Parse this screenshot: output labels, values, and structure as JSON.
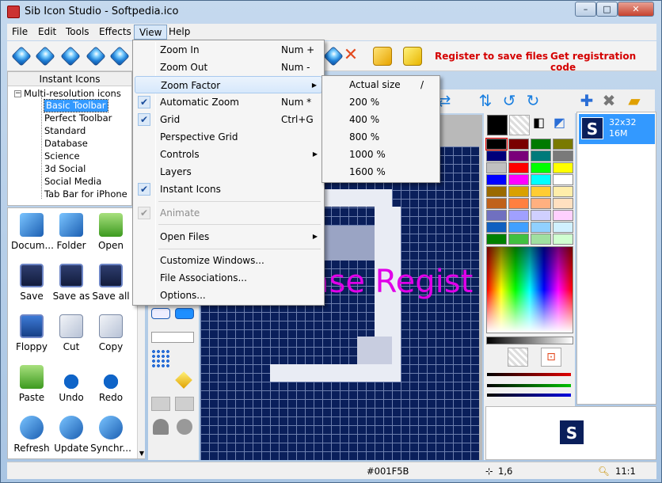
{
  "window": {
    "title": "Sib Icon Studio - Softpedia.ico",
    "minimize": "–",
    "maximize": "□",
    "close": "✕"
  },
  "menubar": {
    "items": [
      "File",
      "Edit",
      "Tools",
      "Effects",
      "View",
      "Help"
    ],
    "active": "View"
  },
  "toolbar": {
    "register_save": "Register to save files",
    "registration_code": "Get registration code"
  },
  "left_panel": {
    "header": "Instant Icons",
    "tree_root": "Multi-resolution icons",
    "tree_items": [
      "Basic Toolbar",
      "Perfect Toolbar",
      "Standard",
      "Database",
      "Science",
      "3d Social",
      "Social Media",
      "Tab Bar for iPhone"
    ],
    "selected": "Basic Toolbar"
  },
  "icon_grid": {
    "items": [
      {
        "label": "Docum...",
        "icon": "document-icon"
      },
      {
        "label": "Folder",
        "icon": "folder-icon"
      },
      {
        "label": "Open",
        "icon": "open-icon"
      },
      {
        "label": "Save",
        "icon": "save-icon"
      },
      {
        "label": "Save as",
        "icon": "save-as-icon"
      },
      {
        "label": "Save all",
        "icon": "save-all-icon"
      },
      {
        "label": "Floppy",
        "icon": "floppy-icon"
      },
      {
        "label": "Cut",
        "icon": "cut-icon"
      },
      {
        "label": "Copy",
        "icon": "copy-icon"
      },
      {
        "label": "Paste",
        "icon": "paste-icon"
      },
      {
        "label": "Undo",
        "icon": "undo-icon"
      },
      {
        "label": "Redo",
        "icon": "redo-icon"
      },
      {
        "label": "Refresh",
        "icon": "refresh-icon"
      },
      {
        "label": "Update",
        "icon": "update-icon"
      },
      {
        "label": "Synchr...",
        "icon": "synchronize-icon"
      }
    ]
  },
  "view_menu": {
    "items": [
      {
        "label": "Zoom In",
        "shortcut": "Num +",
        "checked": false,
        "submenu": false,
        "disabled": false
      },
      {
        "label": "Zoom Out",
        "shortcut": "Num -",
        "checked": false,
        "submenu": false,
        "disabled": false
      },
      {
        "label": "Zoom Factor",
        "shortcut": "",
        "checked": false,
        "submenu": true,
        "disabled": false,
        "highlighted": true
      },
      {
        "label": "Automatic Zoom",
        "shortcut": "Num *",
        "checked": true,
        "submenu": false,
        "disabled": false
      },
      {
        "label": "Grid",
        "shortcut": "Ctrl+G",
        "checked": true,
        "submenu": false,
        "disabled": false
      },
      {
        "label": "Perspective Grid",
        "shortcut": "",
        "checked": false,
        "submenu": false,
        "disabled": false
      },
      {
        "label": "Controls",
        "shortcut": "",
        "checked": false,
        "submenu": true,
        "disabled": false
      },
      {
        "label": "Layers",
        "shortcut": "",
        "checked": false,
        "submenu": false,
        "disabled": false
      },
      {
        "label": "Instant Icons",
        "shortcut": "",
        "checked": true,
        "submenu": false,
        "disabled": false
      },
      {
        "label": "Animate",
        "shortcut": "",
        "checked": true,
        "submenu": false,
        "disabled": true
      },
      {
        "label": "Open Files",
        "shortcut": "",
        "checked": false,
        "submenu": true,
        "disabled": false
      },
      {
        "label": "Customize Windows...",
        "shortcut": "",
        "checked": false,
        "submenu": false,
        "disabled": false
      },
      {
        "label": "File Associations...",
        "shortcut": "",
        "checked": false,
        "submenu": false,
        "disabled": false
      },
      {
        "label": "Options...",
        "shortcut": "",
        "checked": false,
        "submenu": false,
        "disabled": false
      }
    ],
    "check_glyph": "✔",
    "submenu_glyph": "▶"
  },
  "zoom_menu": {
    "items": [
      {
        "label": "Actual size",
        "shortcut": "/"
      },
      {
        "label": "200 %",
        "shortcut": ""
      },
      {
        "label": "400 %",
        "shortcut": ""
      },
      {
        "label": "800 %",
        "shortcut": ""
      },
      {
        "label": "1000 %",
        "shortcut": ""
      },
      {
        "label": "1600 %",
        "shortcut": ""
      }
    ]
  },
  "canvas": {
    "watermark": "ase Regist",
    "background_color": "#0a1f5b"
  },
  "right_panel": {
    "size_line1": "32x32",
    "size_line2": "16M",
    "tile_letter": "S"
  },
  "palette": {
    "swatches": [
      "#000000",
      "#7a0000",
      "#007a00",
      "#7a7a00",
      "#00007a",
      "#7a007a",
      "#007a7a",
      "#7a7a7a",
      "#c0c0c0",
      "#ff0000",
      "#00ff00",
      "#ffff00",
      "#0000ff",
      "#ff00ff",
      "#00ffff",
      "#ffffff",
      "#9a6a00",
      "#d9a100",
      "#ffcc33",
      "#ffeeaa",
      "#c0621a",
      "#ff8040",
      "#ffb080",
      "#ffe0c0",
      "#7070c0",
      "#a0a0ff",
      "#d0d0ff",
      "#ffd0ff",
      "#1060c0",
      "#40a0ff",
      "#90d0ff",
      "#d0f0ff",
      "#008000",
      "#40c040",
      "#a0e0a0",
      "#d0ffd0"
    ]
  },
  "statusbar": {
    "color_hex": "#001F5B",
    "coords": "1,6",
    "zoom": "11:1"
  }
}
